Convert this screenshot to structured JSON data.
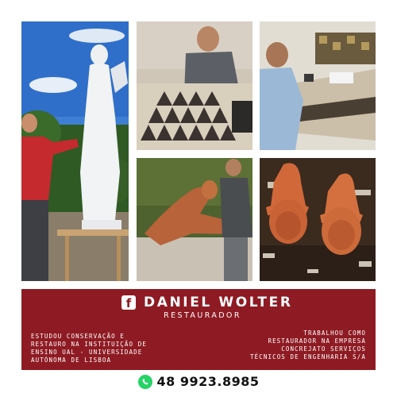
{
  "header": {
    "facebook_icon": "facebook-icon",
    "name": "DANIEL WOLTER",
    "role": "RESTAURADOR"
  },
  "bio": {
    "left_lines": [
      "ESTUDOU CONSERVAÇÃO E",
      "RESTAURO NA INSTITUIÇÃO DE",
      "ENSINO UAL - UNIVERSIDADE",
      "AUTÓNOMA DE LISBOA"
    ],
    "right_lines": [
      "TRABALHOU COMO",
      "RESTAURADOR NA EMPRESA",
      "CONCREJATO SERVIÇOS",
      "TÉCNICOS DE ENGENHARIA S/A"
    ]
  },
  "contact": {
    "icon": "whatsapp-icon",
    "phone": "48 9923.8985"
  },
  "colors": {
    "banner": "#8e1b23",
    "text_on_banner": "#ffffff",
    "whatsapp": "#25d366"
  }
}
